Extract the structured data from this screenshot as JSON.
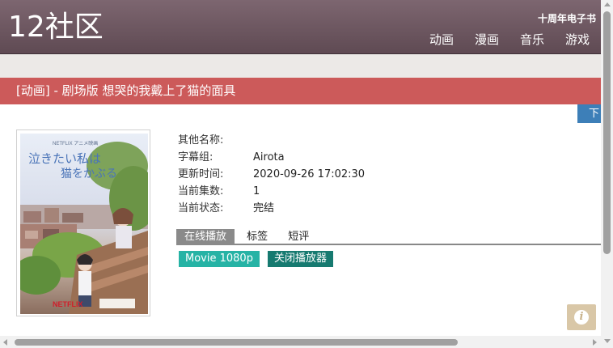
{
  "header": {
    "logo": "12社区",
    "subtitle": "十周年电子书",
    "nav": [
      "动画",
      "漫画",
      "音乐",
      "游戏"
    ]
  },
  "title_bar": {
    "text": "[动画] - 剧场版 想哭的我戴上了猫的面具"
  },
  "download_button": {
    "label": "下"
  },
  "poster": {
    "alt": "泣きたい私は猫をかぶる poster",
    "text_main": "泣きたい私は猫をかぶる",
    "text_badge": "NETFLIX アニメ映画",
    "text_brand": "NETFLIX"
  },
  "info": {
    "alias_label": "其他名称:",
    "alias_value": "",
    "subgroup_label": "字幕组:",
    "subgroup_value": "Airota",
    "updated_label": "更新时间:",
    "updated_value": "2020-09-26 17:02:30",
    "episodes_label": "当前集数:",
    "episodes_value": "1",
    "status_label": "当前状态:",
    "status_value": "完结"
  },
  "tabs": [
    "在线播放",
    "标签",
    "短评"
  ],
  "player_buttons": {
    "movie": "Movie 1080p",
    "close": "关闭播放器"
  },
  "colors": {
    "header": "#6e5862",
    "title_bar": "#cc5a5a",
    "download": "#3d7fb8",
    "teal": "#26b3a5",
    "dark_teal": "#167a70",
    "info_button": "#d9c7a7"
  },
  "icons": {
    "info": "info-icon"
  }
}
